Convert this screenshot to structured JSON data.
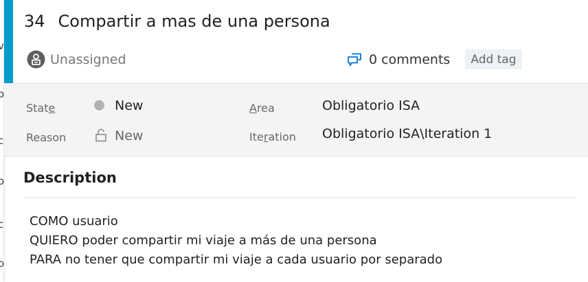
{
  "work_item": {
    "id": "34",
    "title": "Compartir a mas de una persona",
    "assignee": "Unassigned",
    "comments": "0 comments",
    "add_tag": "Add tag"
  },
  "fields": {
    "state": {
      "label_prefix": "Stat",
      "label_access": "e",
      "value": "New"
    },
    "reason": {
      "label": "Reason",
      "value": "New"
    },
    "area": {
      "label_access": "A",
      "label_rest": "rea",
      "value": "Obligatorio ISA"
    },
    "iteration": {
      "label_prefix": "Ite",
      "label_access": "r",
      "label_rest": "ation",
      "value": "Obligatorio ISA\\Iteration 1"
    }
  },
  "description": {
    "heading": "Description",
    "lines": [
      "COMO usuario",
      "QUIERO poder compartir mi viaje a más de una persona",
      "PARA no tener que compartir mi viaje a cada usuario por separado"
    ]
  },
  "left_strip_glyphs": [
    "v",
    "o",
    "c",
    "o",
    "c",
    "o"
  ],
  "colors": {
    "accent": "#009ccc",
    "state_new": "#b2b2b2",
    "comment_icon": "#0078d4",
    "details_background": "#f4f4f4"
  },
  "icons": {
    "assignee": "person-avatar-icon",
    "comments": "chat-bubbles-icon",
    "state": "state-dot-icon",
    "reason": "lock-icon"
  }
}
